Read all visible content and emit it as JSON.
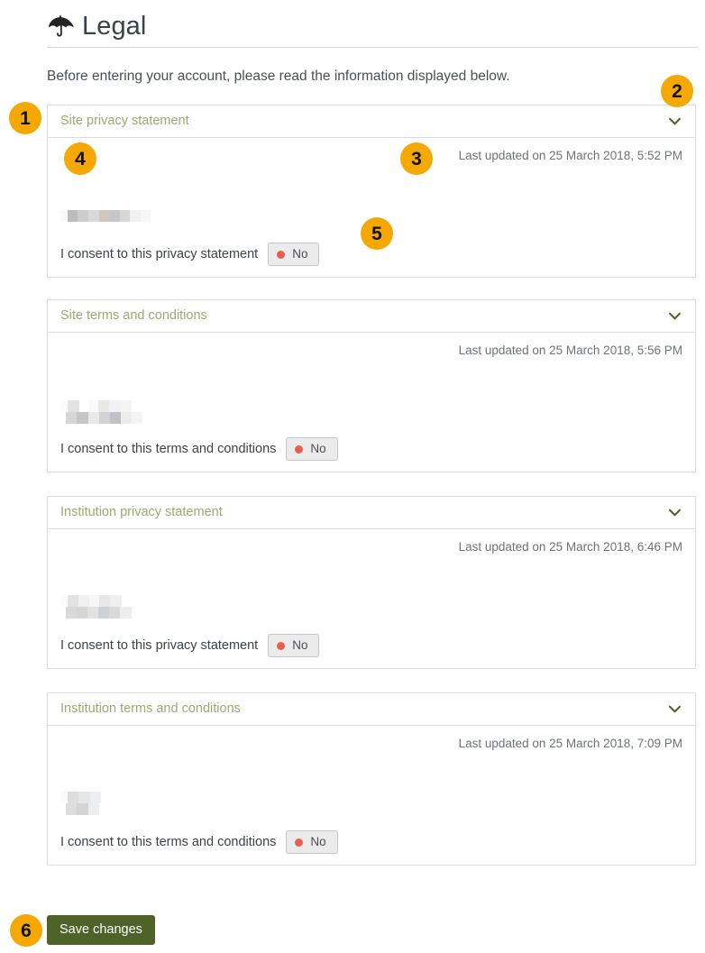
{
  "header": {
    "icon": "umbrella-icon",
    "title": "Legal"
  },
  "intro": {
    "text": "Before entering your account, please read the information displayed below."
  },
  "panels": [
    {
      "title": "Site privacy statement",
      "chevron_icon": "chevron-down-icon",
      "last_updated": "Last updated on 25 March 2018, 5:52 PM",
      "consent_label": "I consent to this privacy statement",
      "consent_value": "No",
      "consent_state_color": "#e8604c",
      "redaction_rows": 1
    },
    {
      "title": "Site terms and conditions",
      "chevron_icon": "chevron-down-icon",
      "last_updated": "Last updated on 25 March 2018, 5:56 PM",
      "consent_label": "I consent to this terms and conditions",
      "consent_value": "No",
      "consent_state_color": "#e8604c",
      "redaction_rows": 2
    },
    {
      "title": "Institution privacy statement",
      "chevron_icon": "chevron-down-icon",
      "last_updated": "Last updated on 25 March 2018, 6:46 PM",
      "consent_label": "I consent to this privacy statement",
      "consent_value": "No",
      "consent_state_color": "#e8604c",
      "redaction_rows": 2
    },
    {
      "title": "Institution terms and conditions",
      "chevron_icon": "chevron-down-icon",
      "last_updated": "Last updated on 25 March 2018, 7:09 PM",
      "consent_label": "I consent to this terms and conditions",
      "consent_value": "No",
      "consent_state_color": "#e8604c",
      "redaction_rows": 2
    }
  ],
  "footer": {
    "save_label": "Save changes",
    "save_color": "#4f6228"
  },
  "callouts": {
    "color": "#f5a800",
    "items": [
      {
        "number": "1"
      },
      {
        "number": "2"
      },
      {
        "number": "3"
      },
      {
        "number": "4"
      },
      {
        "number": "5"
      },
      {
        "number": "6"
      }
    ]
  }
}
